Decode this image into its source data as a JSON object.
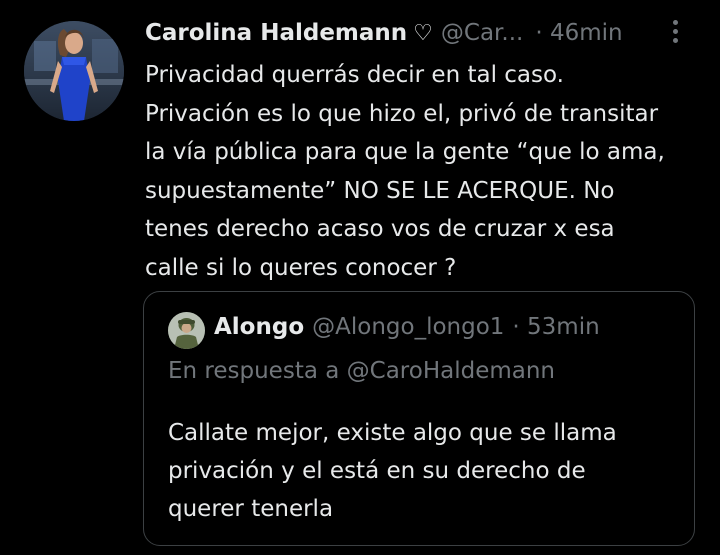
{
  "tweet": {
    "author_name": "Carolina Haldemann",
    "handle": "@Car...",
    "time": "· 46min",
    "text": "Privacidad querrás decir en tal caso.\nPrivación es lo que hizo el, privó de transitar\nla vía pública para que la gente “que lo ama,\nsupuestamente” NO SE LE ACERQUE. No\ntenes derecho acaso vos de cruzar x esa\ncalle si lo queres conocer ?"
  },
  "quote": {
    "author_name": "Alongo",
    "handle": "@Alongo_longo1",
    "time": "· 53min",
    "reply_line": "En respuesta a @CaroHaldemann",
    "text": "Callate mejor, existe algo que se llama\nprivación y el está en su derecho de\nquerer tenerla"
  },
  "icons": {
    "heart": "heart-outline-icon",
    "more": "more-vertical-icon"
  },
  "colors": {
    "background": "#000000",
    "primary_text": "#e7e9ea",
    "secondary_text": "#71767b",
    "border": "#3c4043"
  }
}
